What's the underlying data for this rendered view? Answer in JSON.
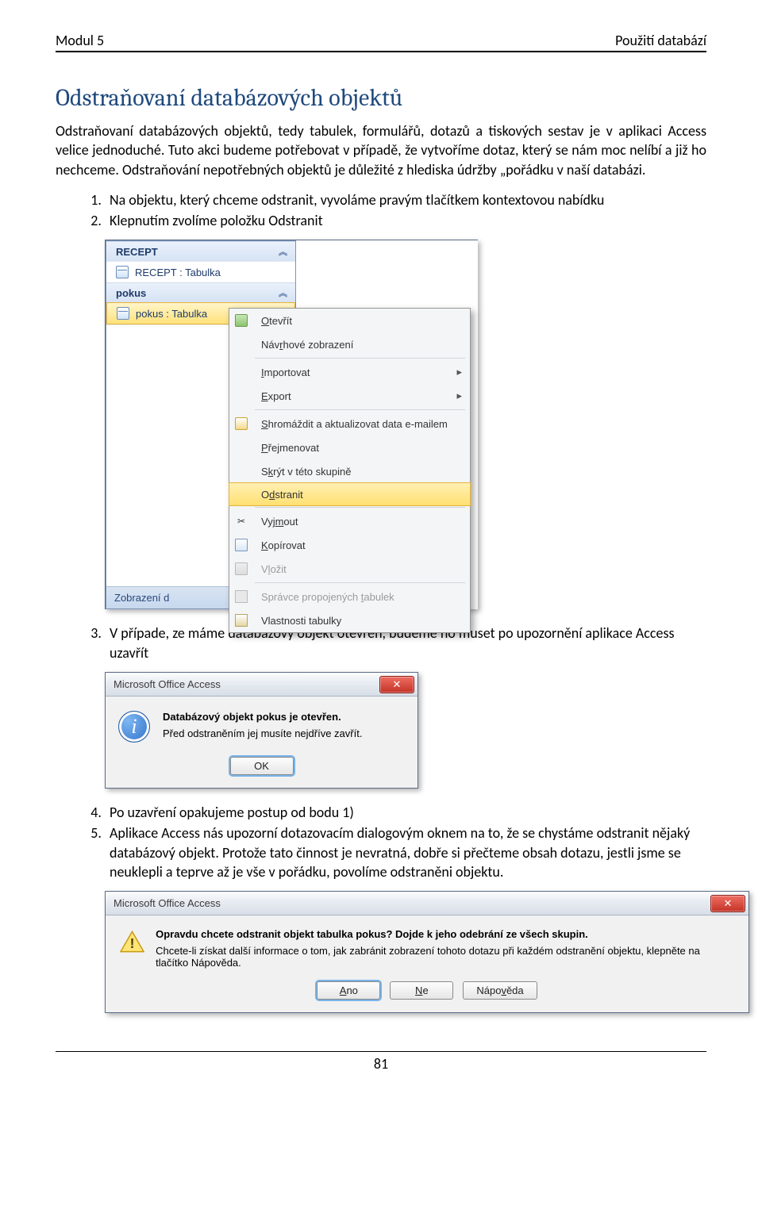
{
  "header": {
    "left": "Modul 5",
    "right": "Použití databází"
  },
  "title": "Odstraňovaní databázových objektů",
  "para1": "Odstraňovaní databázových objektů, tedy tabulek, formulářů, dotazů a tiskových sestav je v aplikaci Access velice jednoduché. Tuto akci budeme potřebovat v případě, že vytvoříme dotaz, který se nám moc nelíbí a již ho nechceme. Odstraňování nepotřebných objektů je důležité z hlediska údržby „pořádku v naší databázi.",
  "step1": "Na objektu, který chceme odstranit, vyvoláme pravým tlačítkem kontextovou nabídku",
  "step2": "Klepnutím zvolíme položku Odstranit",
  "step3": "V případe, ze máme databázový objekt otevřen, budeme ho muset po upozornění aplikace Access uzavřít",
  "step4": "Po uzavření opakujeme postup od bodu 1)",
  "step5": "Aplikace Access nás upozorní dotazovacím dialogovým oknem na to, že se chystáme odstranit nějaký databázový objekt. Protože tato činnost je nevratná, dobře si přečteme obsah dotazu, jestli jsme se neuklepli a teprve až je vše v pořádku, povolíme odstraněni objektu.",
  "nav": {
    "groups": [
      {
        "title": "RECEPT",
        "item": "RECEPT : Tabulka"
      },
      {
        "title": "pokus",
        "item": "pokus : Tabulka"
      }
    ],
    "bottom": "Zobrazení d"
  },
  "ctx": {
    "open": "Otevřít",
    "design": "Návrhové zobrazení",
    "import": "Importovat",
    "export": "Export",
    "email": "Shromáždit a aktualizovat data e-mailem",
    "rename": "Přejmenovat",
    "hide": "Skrýt v této skupině",
    "delete": "Odstranit",
    "cut": "Vyjmout",
    "copy": "Kopírovat",
    "paste": "Vložit",
    "linked": "Správce propojených tabulek",
    "props": "Vlastnosti tabulky"
  },
  "msg1": {
    "title": "Microsoft Office Access",
    "bold": "Databázový objekt pokus je otevřen.",
    "line": "Před odstraněním jej musíte nejdříve zavřít.",
    "ok": "OK"
  },
  "msg2": {
    "title": "Microsoft Office Access",
    "bold": "Opravdu chcete odstranit objekt tabulka pokus? Dojde k jeho odebrání ze všech skupin.",
    "line": "Chcete-li získat další informace o tom, jak zabránit zobrazení tohoto dotazu při každém odstranění objektu, klepněte na tlačítko Nápověda.",
    "yes": "Ano",
    "no": "Ne",
    "help": "Nápověda"
  },
  "page_no": "81"
}
